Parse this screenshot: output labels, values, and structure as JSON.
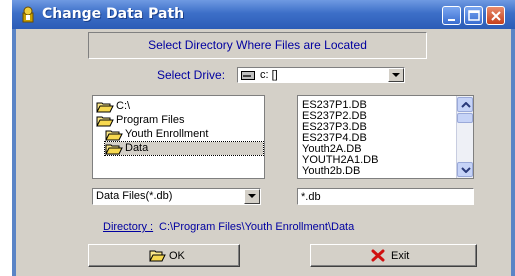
{
  "window": {
    "title": "Change Data Path"
  },
  "banner": {
    "text": "Select Directory Where Files are Located"
  },
  "drive": {
    "label": "Select Drive:",
    "value": "c: []"
  },
  "directories": [
    {
      "label": "C:\\"
    },
    {
      "label": "Program Files"
    },
    {
      "label": "Youth Enrollment"
    },
    {
      "label": "Data"
    }
  ],
  "files": [
    "ES237P1.DB",
    "ES237P2.DB",
    "ES237P3.DB",
    "ES237P4.DB",
    "Youth2A.DB",
    "YOUTH2A1.DB",
    "Youth2b.DB"
  ],
  "file_type": {
    "value": "Data Files(*.db)"
  },
  "filter": {
    "value": "*.db"
  },
  "directory": {
    "label": "Directory :",
    "value": "C:\\Program Files\\Youth Enrollment\\Data"
  },
  "buttons": {
    "ok": "OK",
    "exit": "Exit"
  },
  "icons": [
    "app-icon",
    "minimize-icon",
    "maximize-icon",
    "close-icon",
    "drive-icon",
    "folder-open-icon",
    "chevron-down-icon",
    "chevron-up-icon",
    "open-folder-icon",
    "red-x-icon"
  ],
  "colors": {
    "title_bar": "#2b5cb6",
    "dialog": "#d4d0c8",
    "label_text": "#0000a0",
    "exit_icon": "#d01010"
  }
}
